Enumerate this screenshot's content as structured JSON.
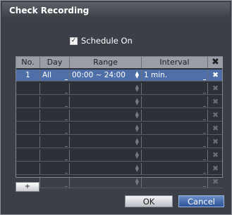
{
  "dialog": {
    "title": "Check Recording"
  },
  "schedule": {
    "label": "Schedule On",
    "checked": true,
    "check_glyph": "✓"
  },
  "table": {
    "headers": [
      "No.",
      "Day",
      "Range",
      "Interval"
    ],
    "delete_glyph": "✖",
    "rows": [
      {
        "no": "1",
        "day": "All",
        "range": "00:00 ~ 24:00",
        "interval": "1 min."
      },
      {
        "no": "",
        "day": "",
        "range": "",
        "interval": ""
      },
      {
        "no": "",
        "day": "",
        "range": "",
        "interval": ""
      },
      {
        "no": "",
        "day": "",
        "range": "",
        "interval": ""
      },
      {
        "no": "",
        "day": "",
        "range": "",
        "interval": ""
      },
      {
        "no": "",
        "day": "",
        "range": "",
        "interval": ""
      },
      {
        "no": "",
        "day": "",
        "range": "",
        "interval": ""
      },
      {
        "no": "",
        "day": "",
        "range": "",
        "interval": ""
      },
      {
        "no": "",
        "day": "",
        "range": "",
        "interval": ""
      }
    ]
  },
  "buttons": {
    "add": "+",
    "ok": "OK",
    "cancel": "Cancel"
  },
  "colors": {
    "accent": "#4f6fa8",
    "cancel": "#2c5299",
    "background": "#3c3f47"
  }
}
